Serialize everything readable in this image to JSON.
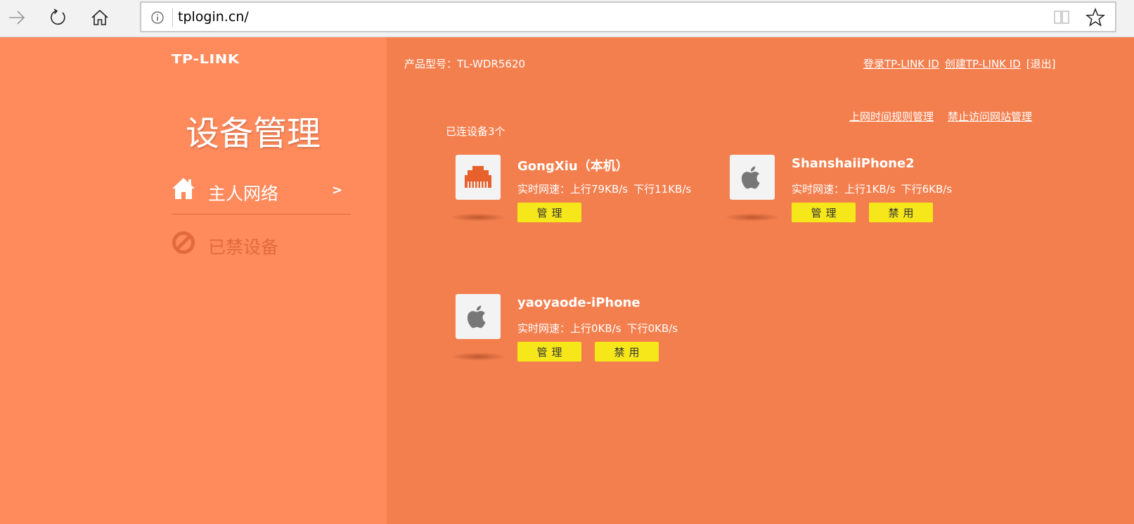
{
  "browser": {
    "url": "tplogin.cn/",
    "icons": [
      "arrow-right-icon",
      "refresh-icon",
      "home-icon",
      "info-icon",
      "reading-view-icon",
      "star-icon"
    ]
  },
  "sidebar": {
    "logo": "TP-LINK",
    "title": "设备管理",
    "nav": [
      {
        "label": "主人网络",
        "arrow": ">",
        "icon": "home-icon",
        "active": true
      },
      {
        "label": "已禁设备",
        "icon": "forbidden-icon",
        "active": false
      }
    ]
  },
  "header": {
    "model_label": "产品型号：TL-WDR5620",
    "links": {
      "login": "登录TP-LINK ID",
      "create": "创建TP-LINK ID",
      "logout": "[退出]"
    }
  },
  "sub_links": {
    "time_rules": "上网时间规则管理",
    "block_sites": "禁止访问网站管理"
  },
  "connected_count": "已连设备3个",
  "devices": [
    {
      "name": "GongXiu（本机）",
      "type": "ethernet-icon",
      "speed_label": "实时网速：",
      "up": "上行79KB/s",
      "down": "下行11KB/s",
      "manage": "管理",
      "block": null
    },
    {
      "name": "ShanshaiiPhone2",
      "type": "apple-icon",
      "speed_label": "实时网速：",
      "up": "上行1KB/s",
      "down": "下行6KB/s",
      "manage": "管理",
      "block": "禁用"
    },
    {
      "name": "yaoyaode-iPhone",
      "type": "apple-icon",
      "speed_label": "实时网速：",
      "up": "上行0KB/s",
      "down": "下行0KB/s",
      "manage": "管理",
      "block": "禁用"
    }
  ],
  "colors": {
    "sidebar_bg": "#ff8a5c",
    "main_bg": "#f47f4e",
    "button_yellow": "#f6e71b",
    "disabled_text": "#e26a3b"
  }
}
